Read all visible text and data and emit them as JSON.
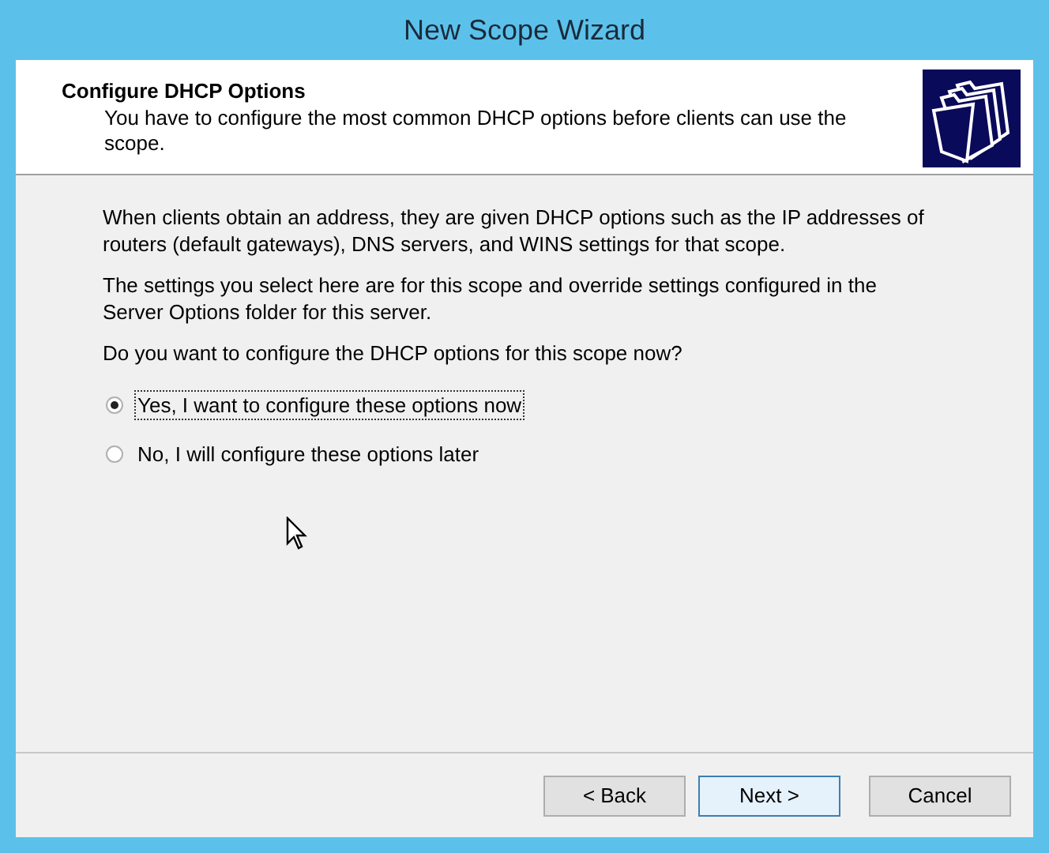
{
  "window": {
    "title": "New Scope Wizard"
  },
  "header": {
    "title": "Configure DHCP Options",
    "subtitle": "You have to configure the most common DHCP options before clients can use the scope."
  },
  "paragraphs": [
    "When clients obtain an address, they are given DHCP options such as the IP addresses of routers (default gateways), DNS servers, and WINS settings for that scope.",
    "The settings you select here are for this scope and override settings configured in the Server Options folder for this server.",
    "Do you want to configure the DHCP options for this scope now?"
  ],
  "options": [
    {
      "label": "Yes, I want to configure these options now",
      "selected": true,
      "focused": true
    },
    {
      "label": "No, I will configure these options later",
      "selected": false,
      "focused": false
    }
  ],
  "buttons": [
    {
      "label": "< Back",
      "default": false
    },
    {
      "label": "Next >",
      "default": true
    },
    {
      "label": "Cancel",
      "default": false
    }
  ]
}
